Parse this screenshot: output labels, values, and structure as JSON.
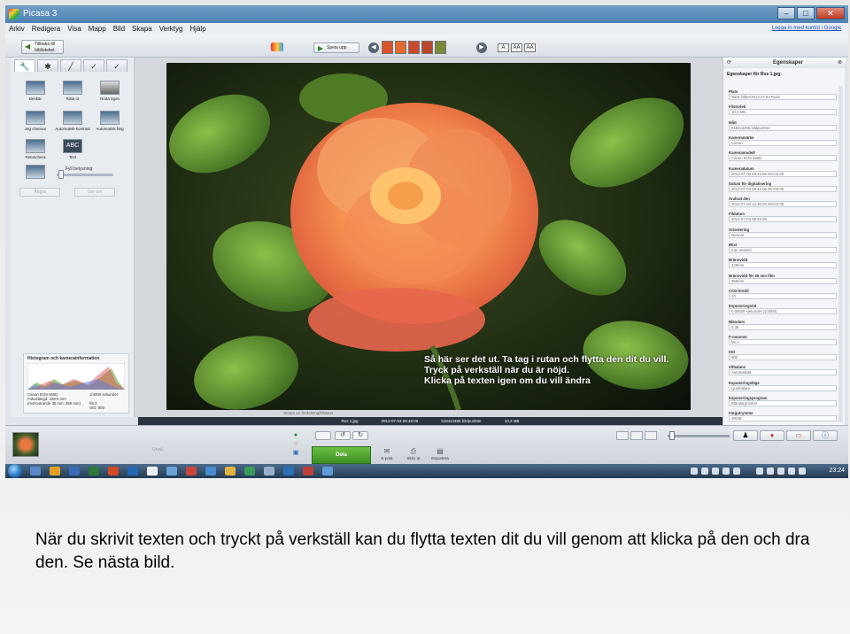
{
  "window": {
    "title": "Picasa 3",
    "controls": [
      "–",
      "□",
      "✕"
    ]
  },
  "menu": {
    "items": [
      "Arkiv",
      "Redigera",
      "Visa",
      "Mapp",
      "Bild",
      "Skapa",
      "Verktyg",
      "Hjälp"
    ],
    "signin": "Logga in med kontot i Google"
  },
  "toolbar": {
    "back_label_1": "Tillbaka till",
    "back_label_2": "biblioteket",
    "play_label": "Spela upp",
    "text_buttons": [
      "A",
      "AA",
      "AA"
    ]
  },
  "left_panel": {
    "tabs": [
      "tools-icon",
      "tuning-icon",
      "brush-icon",
      "effects-icon",
      "more-effects-icon"
    ],
    "tools": [
      {
        "label": "Beskär",
        "icon": "crop-icon"
      },
      {
        "label": "Räta ut",
        "icon": "straighten-icon"
      },
      {
        "label": "Röda ögon",
        "icon": "red-eye-icon"
      },
      {
        "label": "Jag chansar",
        "icon": "lucky-icon"
      },
      {
        "label": "Automatisk kontrast",
        "icon": "auto-contrast-icon"
      },
      {
        "label": "Automatisk färg",
        "icon": "auto-color-icon"
      },
      {
        "label": "Retuschera",
        "icon": "retouch-icon"
      },
      {
        "label": "Text",
        "icon": "text-icon"
      }
    ],
    "fill_light_label": "Fyll belysning",
    "fill_light_value": 0.05,
    "undo_label": "Ångra",
    "redo_label": "Gör om",
    "histogram": {
      "title": "Histogram och kamerainformation",
      "camera": "Canon EOS 550D",
      "focal": "Fokuslängd: 228.0 mm",
      "equiv": "(motsvarande 35 mm: 356 mm)",
      "exposure": "1/4000 sekunder",
      "aperture": "f/8.3",
      "iso": "ISO: 800"
    }
  },
  "photo": {
    "overlay_lines": [
      "Så här ser det ut. Ta tag i rutan och flytta den dit du vill.",
      "Tryck på verkställ när du är nöjd.",
      "Klicka på texten igen om du vill ändra"
    ],
    "caption": "Skapa en fördelning/bildtext"
  },
  "status": {
    "filename": "Ros 1.jpg",
    "date": "2013-07-03 08:45:06",
    "dimensions": "5184x3456 bildpunkter",
    "size": "10,2 MB"
  },
  "properties": {
    "header": "Egenskaper",
    "subtitle": "Egenskaper för Ros 1.jpg:",
    "items": [
      {
        "key": "Plats",
        "value": "Mina bilder\\2013.07.03 Rosn"
      },
      {
        "key": "Filstorlek",
        "value": "10.2 MB"
      },
      {
        "key": "Mått",
        "value": "5184x3456 bildpunkter"
      },
      {
        "key": "Kameramärke",
        "value": "Canon"
      },
      {
        "key": "Kameramodell",
        "value": "Canon EOS 550D"
      },
      {
        "key": "Kameradatum",
        "value": "2013-07-03 08:45:06.00+02:00"
      },
      {
        "key": "Datum för digitalisering",
        "value": "2013-07-03 08:45:06.00+02:00"
      },
      {
        "key": "Ändrad den",
        "value": "2013-07-03 12:36:06.00+02:00"
      },
      {
        "key": "Fildatum",
        "value": "2013-07-03 08:45:06"
      },
      {
        "key": "Orientering",
        "value": "Normal"
      },
      {
        "key": "Blixt",
        "value": "Inte använd"
      },
      {
        "key": "Brännvidd",
        "value": "228mm"
      },
      {
        "key": "Brännvidd för 35 mm film",
        "value": "356mm"
      },
      {
        "key": "CCD-bredd",
        "value": "23"
      },
      {
        "key": "Exponeringstid",
        "value": "0.00025 sekunder (1/4000)"
      },
      {
        "key": "Bländare",
        "value": "5.36"
      },
      {
        "key": "F-nummer",
        "value": "f/8.3"
      },
      {
        "key": "ISO",
        "value": "800"
      },
      {
        "key": "Vitbalans",
        "value": "Automatiskt"
      },
      {
        "key": "Exponeringsläge",
        "value": "Ljusmätare"
      },
      {
        "key": "Exponeringsprogram",
        "value": "Bländarprioritet"
      },
      {
        "key": "Färgutrymme",
        "value": "sRGB"
      }
    ]
  },
  "bottom": {
    "tray_label": "Urval",
    "share_label": "Dela",
    "actions": [
      {
        "label": "E-post",
        "icon": "email-icon"
      },
      {
        "label": "Skriv ut",
        "icon": "print-icon"
      },
      {
        "label": "Exportera",
        "icon": "export-icon"
      }
    ]
  },
  "taskbar": {
    "time": "23:24"
  },
  "slide_caption": "När du skrivit texten och tryckt på verkställ kan du flytta texten dit du vill genom att klicka på den och dra den. Se nästa bild."
}
